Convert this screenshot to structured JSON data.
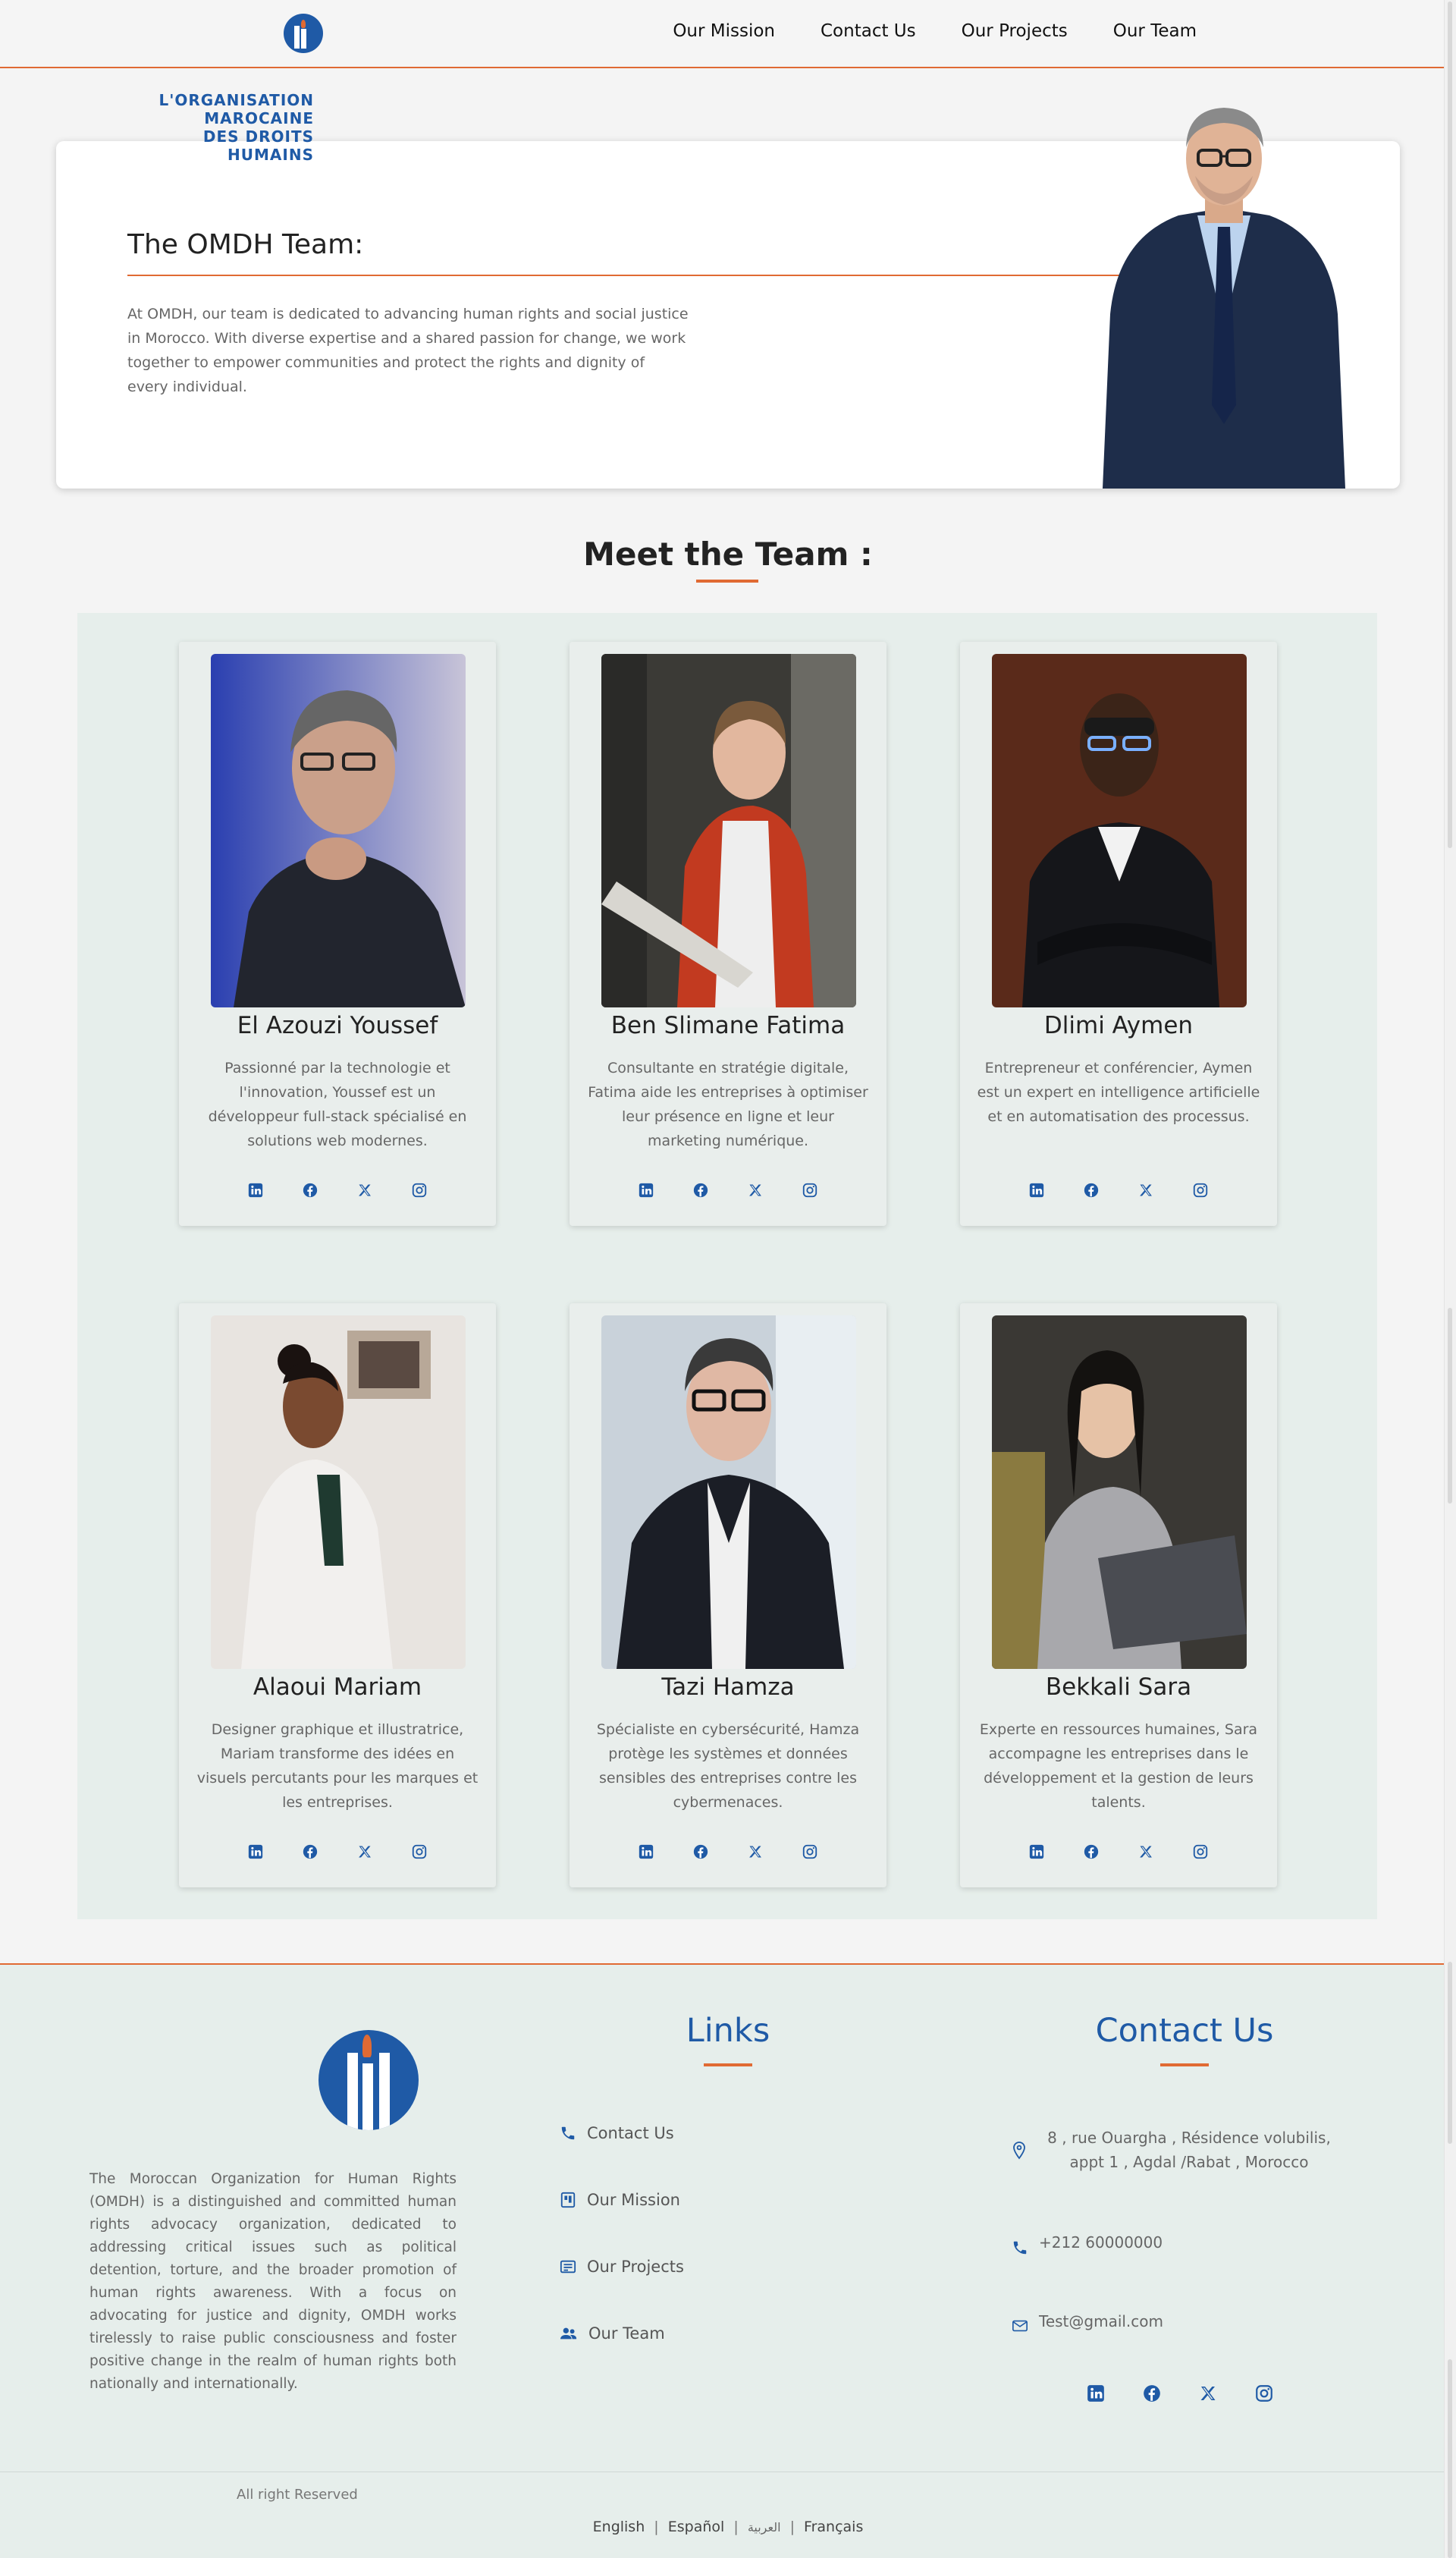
{
  "nav": {
    "links": [
      "Our Mission",
      "Contact Us",
      "Our Projects",
      "Our Team"
    ]
  },
  "hero": {
    "title": "The OMDH Team:",
    "text": "At OMDH, our team is dedicated to advancing human rights and social justice in Morocco. With diverse expertise and a shared passion for change, we work together to empower communities and protect the rights and dignity of every individual."
  },
  "team": {
    "title": "Meet the Team :",
    "members": [
      {
        "name": "El Azouzi Youssef",
        "desc": "Passionné par la technologie et l'innovation, Youssef est un développeur full-stack spécialisé en solutions web modernes."
      },
      {
        "name": "Ben Slimane Fatima",
        "desc": "Consultante en stratégie digitale, Fatima aide les entreprises à optimiser leur présence en ligne et leur marketing numérique."
      },
      {
        "name": "Dlimi Aymen",
        "desc": "Entrepreneur et conférencier, Aymen est un expert en intelligence artificielle et en automatisation des processus."
      },
      {
        "name": "Alaoui Mariam",
        "desc": "Designer graphique et illustratrice, Mariam transforme des idées en visuels percutants pour les marques et les entreprises."
      },
      {
        "name": "Tazi Hamza",
        "desc": "Spécialiste en cybersécurité, Hamza protège les systèmes et données sensibles des entreprises contre les cybermenaces."
      },
      {
        "name": "Bekkali Sara",
        "desc": "Experte en ressources humaines, Sara accompagne les entreprises dans le développement et la gestion de leurs talents."
      }
    ],
    "socials": [
      "linkedin-icon",
      "facebook-icon",
      "x-icon",
      "instagram-icon"
    ]
  },
  "footer": {
    "logo_lines": [
      "L'ORGANISATION",
      "MAROCAINE",
      "DES DROITS HUMAINS"
    ],
    "about": "The Moroccan Organization for Human Rights (OMDH) is a distinguished and committed human rights advocacy organization, dedicated to addressing critical issues such as political detention, torture, and the broader promotion of human rights awareness. With a focus on advocating for justice and dignity, OMDH works tirelessly to raise public consciousness and foster positive change in the realm of human rights both nationally and internationally.",
    "links_title": "Links",
    "links": [
      "Contact Us",
      "Our Mission",
      "Our Projects",
      "Our Team"
    ],
    "contact_title": "Contact Us",
    "address": "8 , rue Ouargha , Résidence volubilis, appt 1 , Agdal /Rabat , Morocco",
    "phone": "+212 60000000",
    "email": "Test@gmail.com",
    "rights": "All right Reserved",
    "languages": [
      "English",
      "Español",
      "العربية",
      "Français"
    ]
  },
  "colors": {
    "accent": "#e06a33",
    "brand": "#1f5aa6",
    "panel": "#e6eeeb"
  }
}
